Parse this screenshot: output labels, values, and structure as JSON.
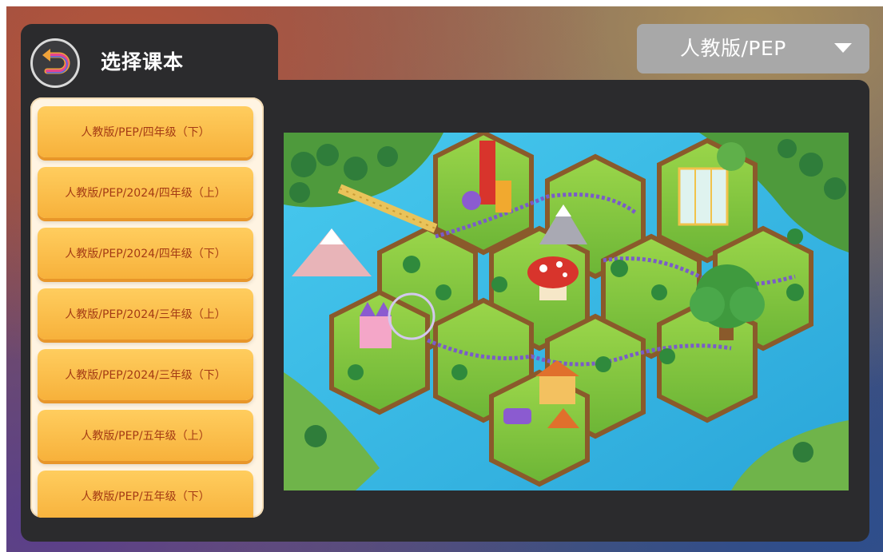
{
  "header": {
    "title": "选择课本",
    "back_icon": "back-arrow-icon"
  },
  "version_select": {
    "selected": "人教版/PEP",
    "caret_icon": "caret-down-icon"
  },
  "books": [
    "人教版/PEP/四年级（下）",
    "人教版/PEP/2024/四年级（上）",
    "人教版/PEP/2024/四年级（下）",
    "人教版/PEP/2024/三年级（上）",
    "人教版/PEP/2024/三年级（下）",
    "人教版/PEP/五年级（上）",
    "人教版/PEP/五年级（下）"
  ],
  "colors": {
    "panel": "#2b2b2d",
    "button": "#f7b13b",
    "button_text": "#a43a14",
    "list_bg": "#fff4e2"
  }
}
